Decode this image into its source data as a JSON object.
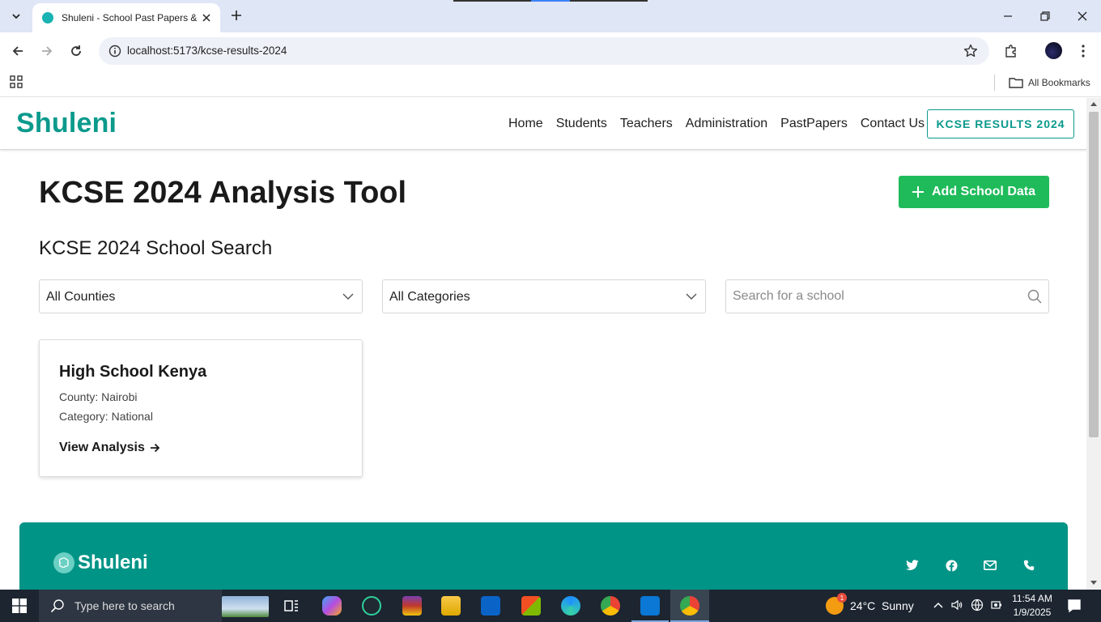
{
  "browser": {
    "tab_title": "Shuleni - School Past Papers & Resources",
    "url": "localhost:5173/kcse-results-2024",
    "bookmarks_label": "All Bookmarks"
  },
  "site": {
    "logo": "Shuleni",
    "nav": [
      "Home",
      "Students",
      "Teachers",
      "Administration",
      "PastPapers",
      "Contact Us"
    ],
    "cta": "KCSE RESULTS 2024",
    "accent": "#0b9a8c"
  },
  "main": {
    "title": "KCSE 2024 Analysis Tool",
    "add_button": "Add School Data",
    "search_heading": "KCSE 2024 School Search",
    "county_select": "All Counties",
    "category_select": "All Categories",
    "search_placeholder": "Search for a school"
  },
  "results": [
    {
      "name": "High School Kenya",
      "county": "County: Nairobi",
      "category": "Category: National",
      "link": "View Analysis"
    }
  ],
  "footer": {
    "logo": "Shuleni",
    "social_icons": [
      "twitter-icon",
      "facebook-icon",
      "mail-icon",
      "phone-icon"
    ]
  },
  "taskbar": {
    "search_placeholder": "Type here to search",
    "weather": "24°C  Sunny",
    "weather_badge": "1",
    "time": "11:54 AM",
    "date": "1/9/2025"
  }
}
